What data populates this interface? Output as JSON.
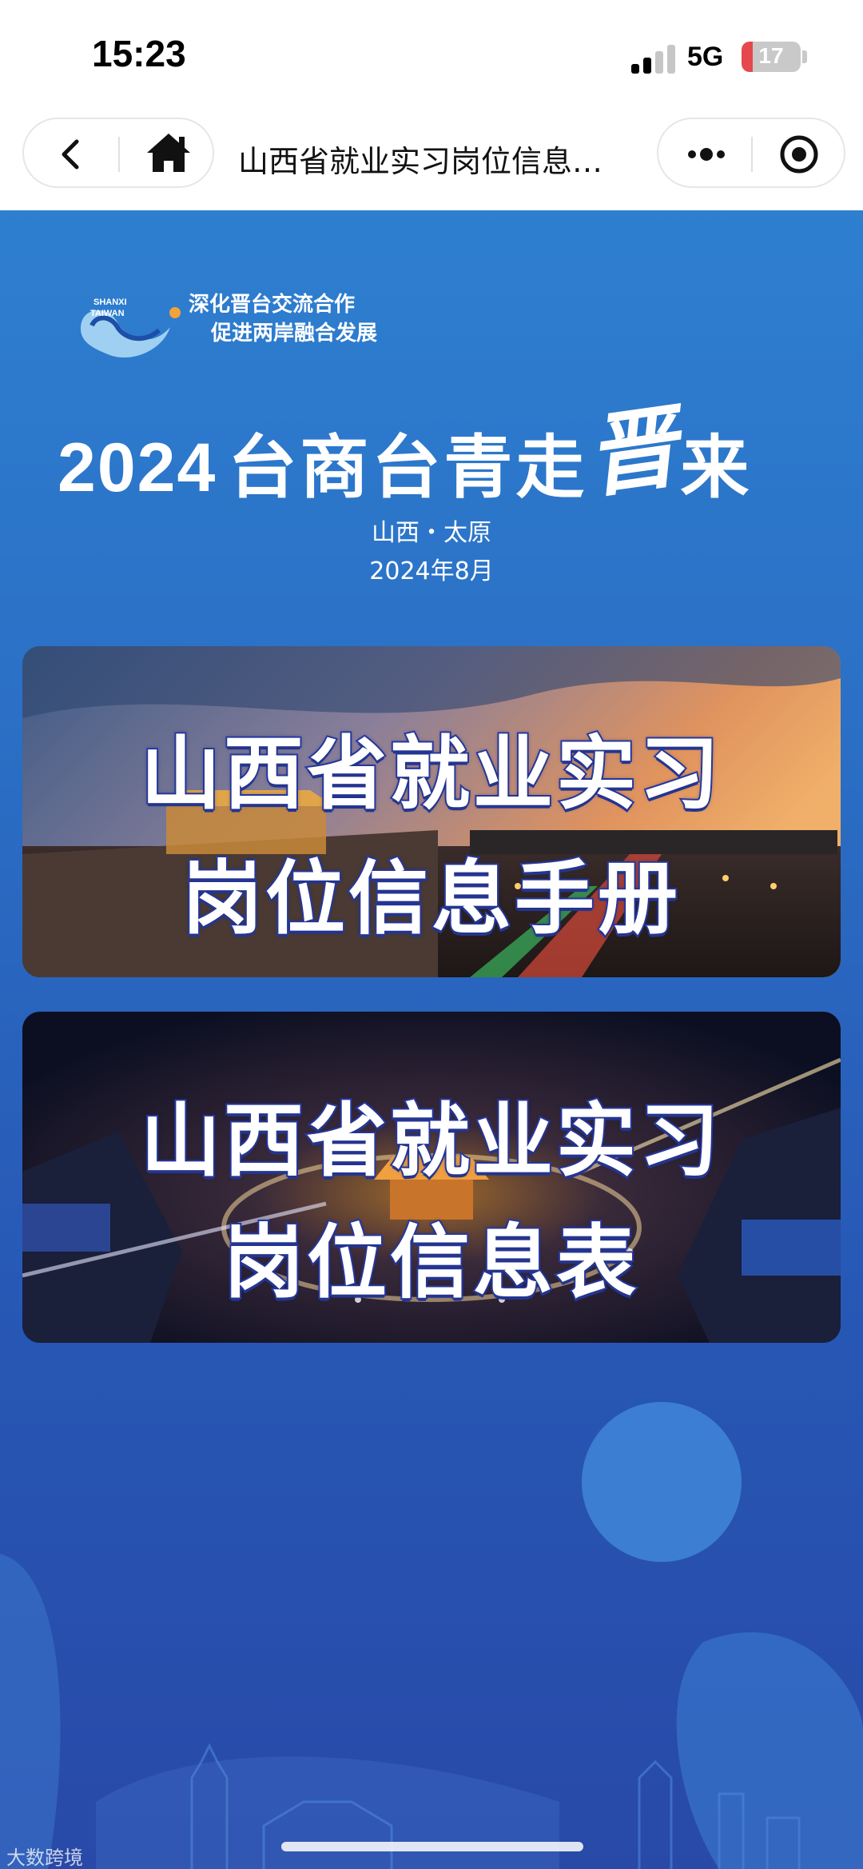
{
  "status_bar": {
    "time": "15:23",
    "network": "5G",
    "battery_level": "17"
  },
  "nav": {
    "title": "山西省就业实习岗位信息…",
    "back_icon": "chevron-left-icon",
    "home_icon": "home-icon",
    "more_icon": "more-dots-icon",
    "close_icon": "target-close-icon"
  },
  "header": {
    "logo_text_top": "SHANXI",
    "logo_text_bottom": "TAIWAN",
    "slogan_line1": "深化晋台交流合作",
    "slogan_line2": "促进两岸融合发展",
    "headline_year": "2024",
    "headline_main": "台商台青走",
    "headline_jin": "晋",
    "headline_end": "来",
    "location": "山西・太原",
    "date": "2024年8月"
  },
  "banners": [
    {
      "line1": "山西省就业实习",
      "line2": "岗位信息手册"
    },
    {
      "line1": "山西省就业实习",
      "line2": "岗位信息表"
    }
  ],
  "footer": {
    "watermark": "大数跨境"
  },
  "colors": {
    "page_blue": "#2b70c6",
    "text_outline": "#2a3ea8",
    "battery_red": "#e5484d"
  }
}
